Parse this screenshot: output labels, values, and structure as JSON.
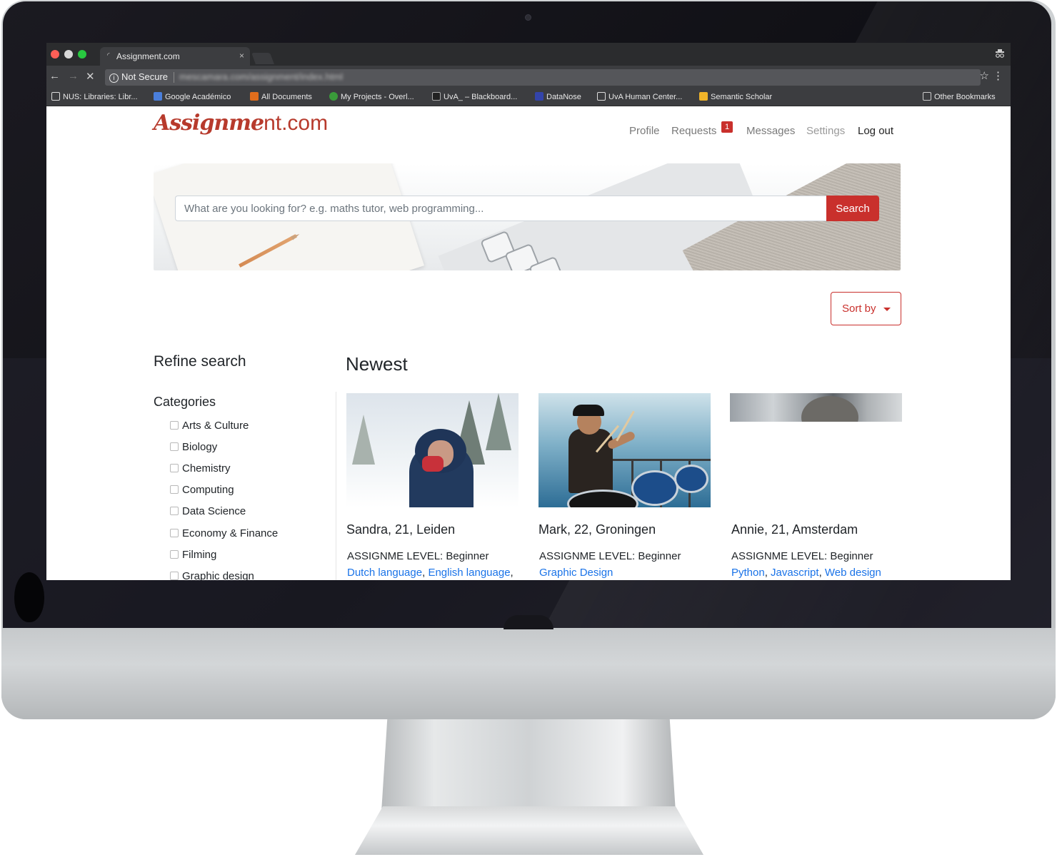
{
  "browser": {
    "tab_title": "Assignment.com",
    "tab_close": "×",
    "security_label": "Not Secure",
    "url": "mescamara.com/assignment/index.html",
    "bookmarks": [
      {
        "label": "NUS: Libraries: Libr...",
        "icon": "page-icon"
      },
      {
        "label": "Google Académico",
        "icon": "google-scholar-icon"
      },
      {
        "label": "All Documents",
        "icon": "elsevier-icon"
      },
      {
        "label": "My Projects - Overl...",
        "icon": "overleaf-icon"
      },
      {
        "label": "UvA_ – Blackboard...",
        "icon": "blackboard-icon"
      },
      {
        "label": "DataNose",
        "icon": "datanose-icon"
      },
      {
        "label": "UvA Human Center...",
        "icon": "page-icon"
      },
      {
        "label": "Semantic Scholar",
        "icon": "semantic-scholar-icon"
      },
      {
        "label": "Other Bookmarks",
        "icon": "folder-icon"
      }
    ]
  },
  "site": {
    "logo_script": "Assignme",
    "logo_plain": "nt.com",
    "brand_color": "#c9302c",
    "nav": {
      "profile": "Profile",
      "requests": "Requests",
      "requests_badge": "1",
      "messages": "Messages",
      "settings": "Settings",
      "logout": "Log out"
    },
    "search": {
      "placeholder": "What are you looking for? e.g. maths tutor, web programming...",
      "button": "Search"
    },
    "sort_label": "Sort by"
  },
  "sidebar": {
    "title": "Refine search",
    "categories_title": "Categories",
    "categories": [
      "Arts & Culture",
      "Biology",
      "Chemistry",
      "Computing",
      "Data Science",
      "Economy & Finance",
      "Filming",
      "Graphic design"
    ]
  },
  "results": {
    "title": "Newest",
    "cards": [
      {
        "name": "Sandra, 21, Leiden",
        "level_label": "ASSIGNME LEVEL:",
        "level": "Beginner",
        "tags": [
          "Dutch language",
          "English language"
        ]
      },
      {
        "name": "Mark, 22, Groningen",
        "level_label": "ASSIGNME LEVEL:",
        "level": "Beginner",
        "tags": [
          "Graphic Design"
        ]
      },
      {
        "name": "Annie, 21, Amsterdam",
        "level_label": "ASSIGNME LEVEL:",
        "level": "Beginner",
        "tags": [
          "Python",
          "Javascript",
          "Web design"
        ]
      }
    ]
  }
}
